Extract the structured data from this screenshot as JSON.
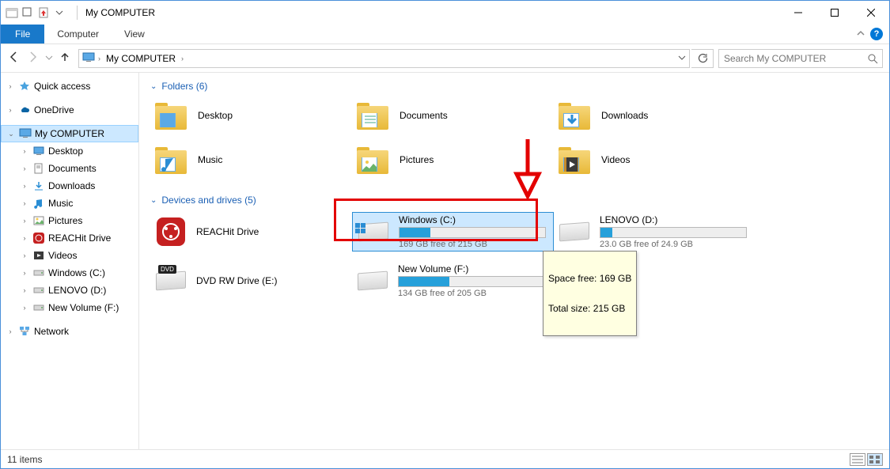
{
  "window": {
    "title": "My COMPUTER"
  },
  "ribbon": {
    "file": "File",
    "tabs": [
      "Computer",
      "View"
    ]
  },
  "address": {
    "crumbs": [
      "My COMPUTER"
    ]
  },
  "search": {
    "placeholder": "Search My COMPUTER"
  },
  "sidebar": {
    "quick_access": "Quick access",
    "onedrive": "OneDrive",
    "my_computer": "My COMPUTER",
    "children": [
      {
        "label": "Desktop",
        "icon": "desktop"
      },
      {
        "label": "Documents",
        "icon": "documents"
      },
      {
        "label": "Downloads",
        "icon": "downloads"
      },
      {
        "label": "Music",
        "icon": "music"
      },
      {
        "label": "Pictures",
        "icon": "pictures"
      },
      {
        "label": "REACHit Drive",
        "icon": "reachit"
      },
      {
        "label": "Videos",
        "icon": "videos"
      },
      {
        "label": "Windows (C:)",
        "icon": "drive"
      },
      {
        "label": "LENOVO (D:)",
        "icon": "drive"
      },
      {
        "label": "New Volume (F:)",
        "icon": "drive"
      }
    ],
    "network": "Network"
  },
  "groups": {
    "folders": {
      "title": "Folders (6)",
      "items": [
        "Desktop",
        "Documents",
        "Downloads",
        "Music",
        "Pictures",
        "Videos"
      ]
    },
    "devices": {
      "title": "Devices and drives (5)",
      "items": [
        {
          "name": "REACHit Drive",
          "type": "app",
          "sub": ""
        },
        {
          "name": "Windows (C:)",
          "type": "drive",
          "sub": "169 GB free of 215 GB",
          "fill": 21
        },
        {
          "name": "LENOVO (D:)",
          "type": "drive",
          "sub": "23.0 GB free of 24.9 GB",
          "fill": 8
        },
        {
          "name": "DVD RW Drive (E:)",
          "type": "dvd",
          "sub": ""
        },
        {
          "name": "New Volume (F:)",
          "type": "drive",
          "sub": "134 GB free of 205 GB",
          "fill": 35
        }
      ]
    }
  },
  "tooltip": {
    "line1": "Space free: 169 GB",
    "line2": "Total size: 215 GB"
  },
  "statusbar": {
    "count": "11 items"
  }
}
